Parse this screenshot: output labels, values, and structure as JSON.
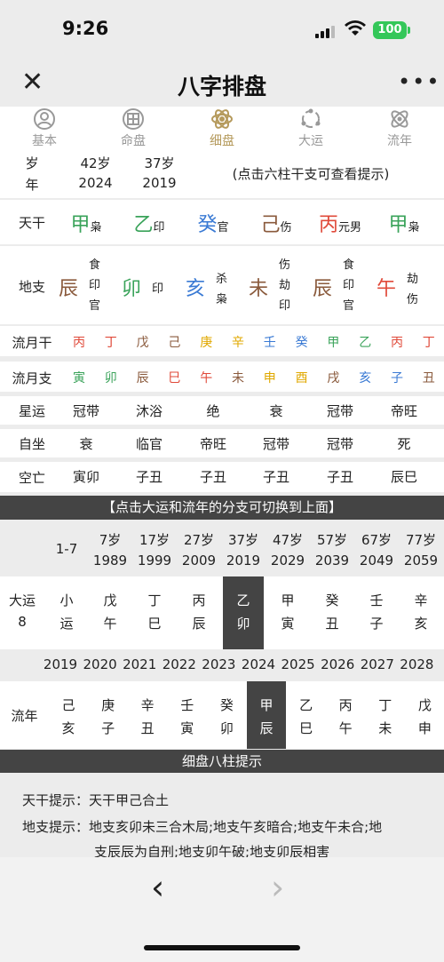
{
  "status": {
    "time": "9:26",
    "battery": "100"
  },
  "nav": {
    "title": "八字排盘",
    "close": "✕",
    "more": "•••"
  },
  "tabs": [
    {
      "label": "基本"
    },
    {
      "label": "命盘"
    },
    {
      "label": "细盘"
    },
    {
      "label": "大运"
    },
    {
      "label": "流年"
    }
  ],
  "top": {
    "label_a": "岁",
    "label_b": "年",
    "ages": [
      "42岁",
      "37岁"
    ],
    "years": [
      "2024",
      "2019"
    ],
    "hint": "(点击六柱干支可查看提示)"
  },
  "tiangan": {
    "label": "天干",
    "items": [
      {
        "gan": "甲",
        "shen": "枭",
        "color": "#3aa35a"
      },
      {
        "gan": "乙",
        "shen": "印",
        "color": "#3aa35a"
      },
      {
        "gan": "癸",
        "shen": "官",
        "color": "#3a7ad4"
      },
      {
        "gan": "己",
        "shen": "伤",
        "color": "#8a5a3c"
      },
      {
        "gan": "丙",
        "shen": "元男",
        "color": "#e04a3a"
      },
      {
        "gan": "甲",
        "shen": "枭",
        "color": "#3aa35a"
      }
    ]
  },
  "dizhi": {
    "label": "地支",
    "items": [
      {
        "zhi": "辰",
        "color": "#8a5a3c",
        "cang": [
          "食",
          "印",
          "官"
        ]
      },
      {
        "zhi": "卯",
        "color": "#3aa35a",
        "cang": [
          "印"
        ]
      },
      {
        "zhi": "亥",
        "color": "#3a7ad4",
        "cang": [
          "杀",
          "枭"
        ]
      },
      {
        "zhi": "未",
        "color": "#8a5a3c",
        "cang": [
          "伤",
          "劫",
          "印"
        ]
      },
      {
        "zhi": "辰",
        "color": "#8a5a3c",
        "cang": [
          "食",
          "印",
          "官"
        ]
      },
      {
        "zhi": "午",
        "color": "#e04a3a",
        "cang": [
          "劫",
          "伤"
        ]
      }
    ]
  },
  "liuyuegan": {
    "label": "流月干",
    "items": [
      {
        "t": "丙",
        "c": "#e04a3a"
      },
      {
        "t": "丁",
        "c": "#e04a3a"
      },
      {
        "t": "戊",
        "c": "#8a5a3c"
      },
      {
        "t": "己",
        "c": "#8a5a3c"
      },
      {
        "t": "庚",
        "c": "#e0a800"
      },
      {
        "t": "辛",
        "c": "#e0a800"
      },
      {
        "t": "壬",
        "c": "#3a7ad4"
      },
      {
        "t": "癸",
        "c": "#3a7ad4"
      },
      {
        "t": "甲",
        "c": "#3aa35a"
      },
      {
        "t": "乙",
        "c": "#3aa35a"
      },
      {
        "t": "丙",
        "c": "#e04a3a"
      },
      {
        "t": "丁",
        "c": "#e04a3a"
      }
    ]
  },
  "liuyuezhi": {
    "label": "流月支",
    "items": [
      {
        "t": "寅",
        "c": "#3aa35a"
      },
      {
        "t": "卯",
        "c": "#3aa35a"
      },
      {
        "t": "辰",
        "c": "#8a5a3c"
      },
      {
        "t": "巳",
        "c": "#e04a3a"
      },
      {
        "t": "午",
        "c": "#e04a3a"
      },
      {
        "t": "未",
        "c": "#8a5a3c"
      },
      {
        "t": "申",
        "c": "#e0a800"
      },
      {
        "t": "酉",
        "c": "#e0a800"
      },
      {
        "t": "戌",
        "c": "#8a5a3c"
      },
      {
        "t": "亥",
        "c": "#3a7ad4"
      },
      {
        "t": "子",
        "c": "#3a7ad4"
      },
      {
        "t": "丑",
        "c": "#8a5a3c"
      }
    ]
  },
  "xingyun": {
    "label": "星运",
    "items": [
      "冠带",
      "沐浴",
      "绝",
      "衰",
      "冠带",
      "帝旺"
    ]
  },
  "zizuo": {
    "label": "自坐",
    "items": [
      "衰",
      "临官",
      "帝旺",
      "冠带",
      "冠带",
      "死"
    ]
  },
  "kongwang": {
    "label": "空亡",
    "items": [
      "寅卯",
      "子丑",
      "子丑",
      "子丑",
      "子丑",
      "辰巳"
    ]
  },
  "banner1": "【点击大运和流年的分支可切换到上面】",
  "dayun_head": {
    "first": "1-7",
    "ages": [
      "7岁",
      "17岁",
      "27岁",
      "37岁",
      "47岁",
      "57岁",
      "67岁",
      "77岁"
    ],
    "years": [
      "1989",
      "1999",
      "2009",
      "2019",
      "2029",
      "2039",
      "2049",
      "2059"
    ]
  },
  "dayun": {
    "label_a": "大运",
    "label_b": "8",
    "first_a": "小",
    "first_b": "运",
    "items": [
      [
        "戊",
        "午"
      ],
      [
        "丁",
        "巳"
      ],
      [
        "丙",
        "辰"
      ],
      [
        "乙",
        "卯"
      ],
      [
        "甲",
        "寅"
      ],
      [
        "癸",
        "丑"
      ],
      [
        "壬",
        "子"
      ],
      [
        "辛",
        "亥"
      ]
    ]
  },
  "liunian_years": [
    "2019",
    "2020",
    "2021",
    "2022",
    "2023",
    "2024",
    "2025",
    "2026",
    "2027",
    "2028"
  ],
  "liunian": {
    "label": "流年",
    "items": [
      [
        "己",
        "亥"
      ],
      [
        "庚",
        "子"
      ],
      [
        "辛",
        "丑"
      ],
      [
        "壬",
        "寅"
      ],
      [
        "癸",
        "卯"
      ],
      [
        "甲",
        "辰"
      ],
      [
        "乙",
        "巳"
      ],
      [
        "丙",
        "午"
      ],
      [
        "丁",
        "未"
      ],
      [
        "戊",
        "申"
      ]
    ]
  },
  "banner2": "细盘八柱提示",
  "tips": {
    "tiangan": "天干提示：天干甲己合土",
    "dizhi_1": "地支提示：地支亥卯未三合木局;地支午亥暗合;地支午未合;地",
    "dizhi_2": "支辰辰为自刑;地支卯午破;地支卯辰相害"
  },
  "bottom": {
    "back": "‹",
    "forward": "›"
  }
}
